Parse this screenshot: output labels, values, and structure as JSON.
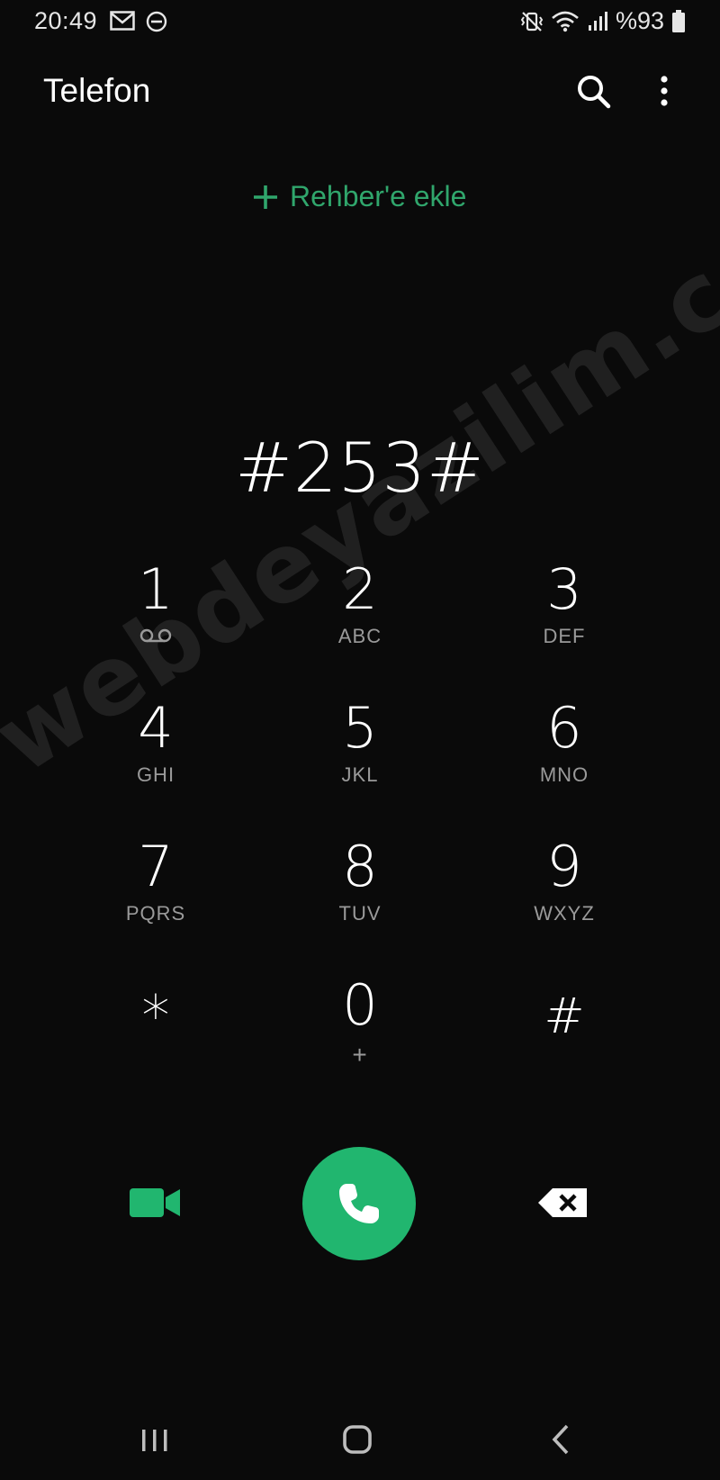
{
  "status_bar": {
    "time": "20:49",
    "battery": "%93",
    "icons": [
      "mail-icon",
      "do-not-disturb-icon",
      "vibrate-icon",
      "wifi-icon",
      "signal-icon",
      "battery-icon"
    ]
  },
  "app_bar": {
    "title": "Telefon",
    "actions": [
      "search-icon",
      "more-icon"
    ]
  },
  "add_contact": {
    "label": "Rehber'e ekle",
    "color": "#30a66c"
  },
  "dialed_number": "#253#",
  "keypad": {
    "keys": [
      {
        "digit": "1",
        "letters": "",
        "icon": "voicemail-icon"
      },
      {
        "digit": "2",
        "letters": "ABC"
      },
      {
        "digit": "3",
        "letters": "DEF"
      },
      {
        "digit": "4",
        "letters": "GHI"
      },
      {
        "digit": "5",
        "letters": "JKL"
      },
      {
        "digit": "6",
        "letters": "MNO"
      },
      {
        "digit": "7",
        "letters": "PQRS"
      },
      {
        "digit": "8",
        "letters": "TUV"
      },
      {
        "digit": "9",
        "letters": "WXYZ"
      },
      {
        "digit": "*",
        "letters": ""
      },
      {
        "digit": "0",
        "letters": "+"
      },
      {
        "digit": "#",
        "letters": ""
      }
    ]
  },
  "actions": {
    "video_icon": "video-call-icon",
    "call_icon": "phone-icon",
    "delete_icon": "backspace-icon",
    "accent_color": "#21b66f"
  },
  "navigation": {
    "items": [
      "recents-icon",
      "home-icon",
      "back-icon"
    ]
  },
  "watermark": "webdeyazilim.com"
}
